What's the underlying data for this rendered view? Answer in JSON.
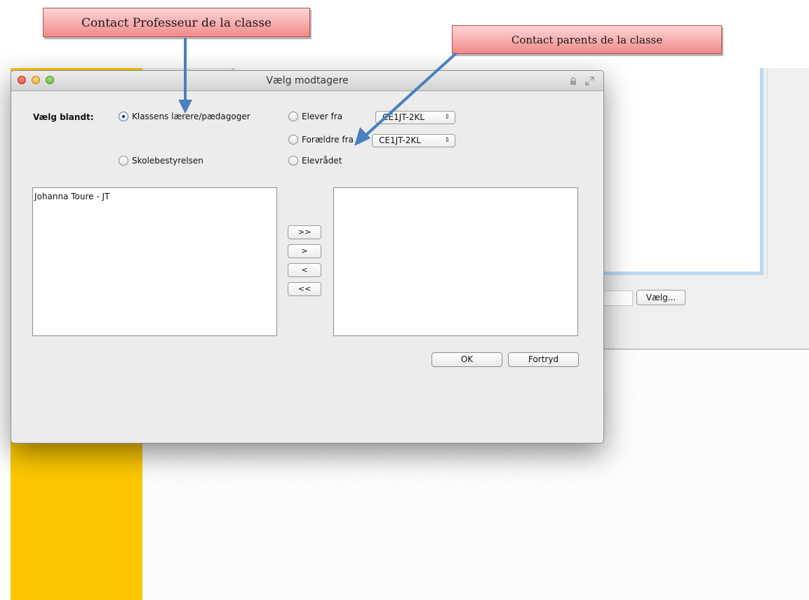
{
  "background": {
    "choose_button_label": "Vælg..."
  },
  "annotations": {
    "teacher_callout": "Contact Professeur de la classe",
    "parents_callout": "Contact parents de la classe"
  },
  "dialog": {
    "title": "Vælg modtagere",
    "choose_among_label": "Vælg blandt:",
    "radios": {
      "class_teachers": "Klassens lærere/pædagoger",
      "students_from": "Elever fra",
      "parents_from": "Forældre fra",
      "school_board": "Skolebestyrelsen",
      "student_council": "Elevrådet"
    },
    "class_selects": {
      "students_value": "CE1JT-2KL",
      "parents_value": "CE1JT-2KL"
    },
    "available_list": [
      "Johanna Toure - JT"
    ],
    "selected_list": [],
    "move_buttons": {
      "add_all": ">>",
      "add": ">",
      "remove": "<",
      "remove_all": "<<"
    },
    "ok_label": "OK",
    "cancel_label": "Fortryd"
  },
  "colors": {
    "sidebar_yellow": "#fdc700",
    "callout_red": "#f08a8a",
    "arrow_blue": "#4a7fc0"
  },
  "icons": {
    "window_close": "close-icon",
    "window_minimize": "minimize-icon",
    "window_maximize": "maximize-icon",
    "lock": "lock-icon",
    "fullscreen": "fullscreen-icon",
    "select_caret": "updown-caret-icon"
  }
}
